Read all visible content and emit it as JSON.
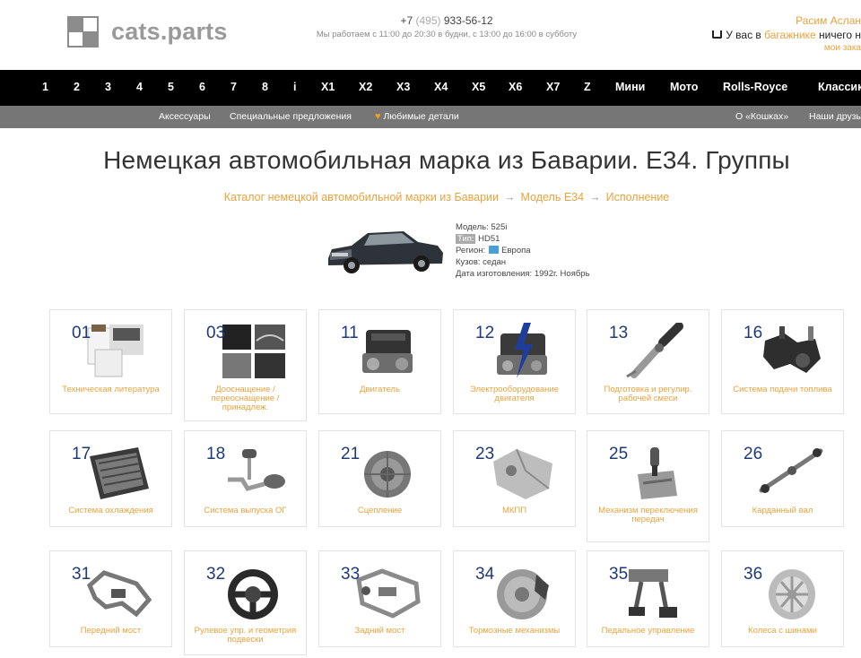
{
  "header": {
    "logo_text": "cats.parts",
    "phone_prefix": "+7",
    "phone_code": "(495)",
    "phone_number": "933-56-12",
    "hours": "Мы работаем с 11:00 до 20:30 в будни, с 13:00 до 16:00 в субботу",
    "user_name": "Расим Аслан",
    "cart_pre": "У вас в",
    "cart_link": "багажнике",
    "cart_post": "ничего н",
    "orders": "мои зака"
  },
  "mainnav": [
    "1",
    "2",
    "3",
    "4",
    "5",
    "6",
    "7",
    "8",
    "i",
    "X1",
    "X2",
    "X3",
    "X4",
    "X5",
    "X6",
    "X7",
    "Z",
    "Мини",
    "Мото",
    "Rolls-Royce",
    "Классика"
  ],
  "subnav": {
    "accessories": "Аксессуары",
    "offers": "Специальные предложения",
    "favorites": "Любимые детали",
    "about": "О «Кошках»",
    "friends": "Наши друзь"
  },
  "page": {
    "title": "Немецкая автомобильная марка из Баварии. E34. Группы",
    "breadcrumbs": [
      "Каталог немецкой автомобильной марки из Баварии",
      "Модель E34",
      "Исполнение"
    ]
  },
  "car": {
    "model_label": "Модель:",
    "model": "525i",
    "type_label": "Тип:",
    "type": "HD51",
    "region_label": "Регион:",
    "region": "Европа",
    "body_label": "Кузов:",
    "body": "седан",
    "date_label": "Дата изготовления:",
    "date": "1992г. Ноябрь"
  },
  "groups": [
    {
      "num": "01",
      "label": "Техническая литература",
      "icon": "book-icon"
    },
    {
      "num": "03",
      "label": "Дооснащение / переоснащение / принадлеж.",
      "icon": "accessories-icon"
    },
    {
      "num": "11",
      "label": "Двигатель",
      "icon": "engine-icon"
    },
    {
      "num": "12",
      "label": "Электрооборудование двигателя",
      "icon": "electric-engine-icon"
    },
    {
      "num": "13",
      "label": "Подготовка и регулир. рабочей смеси",
      "icon": "injector-icon"
    },
    {
      "num": "16",
      "label": "Система подачи топлива",
      "icon": "fuel-system-icon"
    },
    {
      "num": "17",
      "label": "Система охлаждения",
      "icon": "radiator-icon"
    },
    {
      "num": "18",
      "label": "Система выпуска ОГ",
      "icon": "exhaust-icon"
    },
    {
      "num": "21",
      "label": "Сцепление",
      "icon": "clutch-icon"
    },
    {
      "num": "23",
      "label": "МКПП",
      "icon": "gearbox-icon"
    },
    {
      "num": "25",
      "label": "Механизм переключения передач",
      "icon": "shifter-icon"
    },
    {
      "num": "26",
      "label": "Карданный вал",
      "icon": "driveshaft-icon"
    },
    {
      "num": "31",
      "label": "Передний мост",
      "icon": "front-axle-icon"
    },
    {
      "num": "32",
      "label": "Рулевое упр. и геометрия подвески",
      "icon": "steering-wheel-icon"
    },
    {
      "num": "33",
      "label": "Задний мост",
      "icon": "rear-axle-icon"
    },
    {
      "num": "34",
      "label": "Тормозные механизмы",
      "icon": "brake-disc-icon"
    },
    {
      "num": "35",
      "label": "Педальное управление",
      "icon": "pedals-icon"
    },
    {
      "num": "36",
      "label": "Колеса с шинами",
      "icon": "wheel-icon"
    }
  ]
}
